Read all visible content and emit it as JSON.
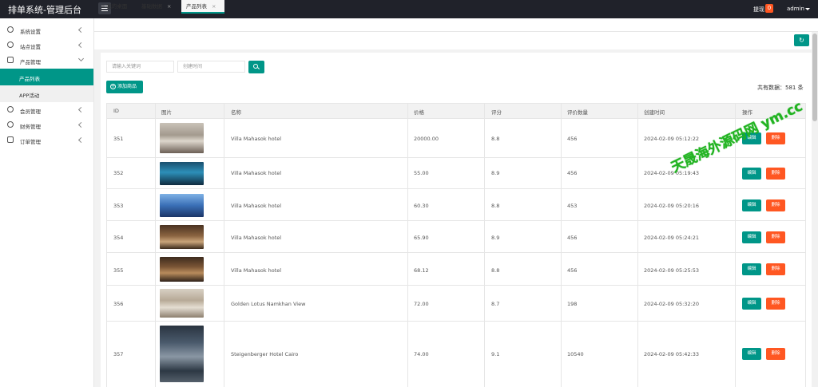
{
  "app": {
    "title": "排单系统-管理后台"
  },
  "header": {
    "notice_label": "提现",
    "notice_count": "0",
    "user": "admin"
  },
  "sidebar": {
    "items": [
      {
        "label": "系统设置"
      },
      {
        "label": "站点设置"
      },
      {
        "label": "产品管理"
      },
      {
        "label": "会员管理"
      },
      {
        "label": "财务管理"
      },
      {
        "label": "订单管理"
      }
    ],
    "sub_items": [
      {
        "label": "产品列表"
      },
      {
        "label": "APP活动"
      }
    ]
  },
  "tabs": [
    {
      "label": "我的桌面"
    },
    {
      "label": "基础数据"
    },
    {
      "label": "产品列表"
    }
  ],
  "search": {
    "keyword_placeholder": "请输入关键词",
    "time_placeholder": "创建时间"
  },
  "toolbar": {
    "add_label": "添加商品",
    "total_label": "共有数据：581 条"
  },
  "table": {
    "headers": [
      "ID",
      "图片",
      "名称",
      "价格",
      "评分",
      "评价数量",
      "创建时间",
      "操作"
    ],
    "edit_label": "编辑",
    "delete_label": "删除",
    "rows": [
      {
        "id": "351",
        "name": "Villa Mahasok hotel",
        "price": "20000.00",
        "rating": "8.8",
        "reviews": "456",
        "created": "2024-02-09 05:12:22"
      },
      {
        "id": "352",
        "name": "Villa Mahasok hotel",
        "price": "55.00",
        "rating": "8.9",
        "reviews": "456",
        "created": "2024-02-09 05:19:43"
      },
      {
        "id": "353",
        "name": "Villa Mahasok hotel",
        "price": "60.30",
        "rating": "8.8",
        "reviews": "453",
        "created": "2024-02-09 05:20:16"
      },
      {
        "id": "354",
        "name": "Villa Mahasok hotel",
        "price": "65.90",
        "rating": "8.9",
        "reviews": "456",
        "created": "2024-02-09 05:24:21"
      },
      {
        "id": "355",
        "name": "Villa Mahasok hotel",
        "price": "68.12",
        "rating": "8.8",
        "reviews": "456",
        "created": "2024-02-09 05:25:53"
      },
      {
        "id": "356",
        "name": "Golden Lotus Namkhan View",
        "price": "72.00",
        "rating": "8.7",
        "reviews": "198",
        "created": "2024-02-09 05:32:20"
      },
      {
        "id": "357",
        "name": "Steigenberger Hotel Cairo",
        "price": "74.00",
        "rating": "9.1",
        "reviews": "10540",
        "created": "2024-02-09 05:42:33"
      }
    ]
  },
  "watermark": "天晟海外源码网 ym.cc",
  "colors": {
    "accent": "#009688",
    "danger": "#ff5722",
    "topbar": "#20222a"
  }
}
